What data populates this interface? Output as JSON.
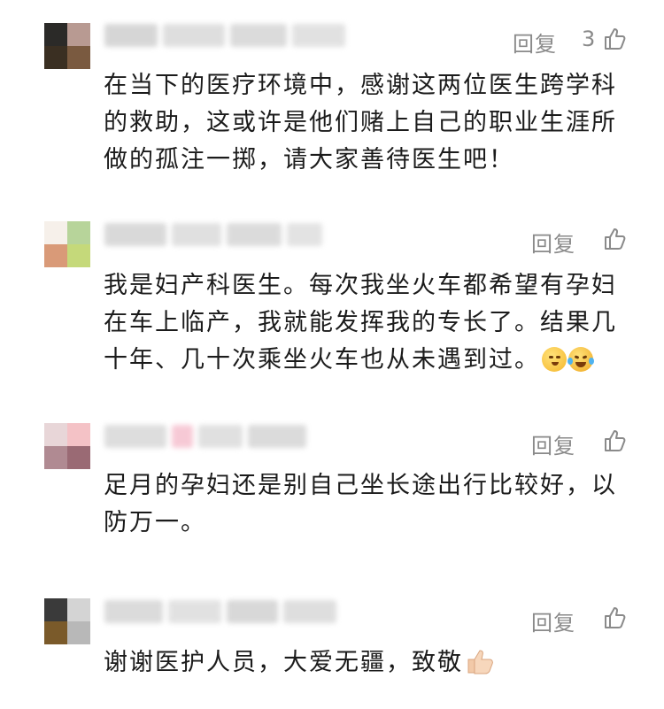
{
  "comments": [
    {
      "reply_label": "回复",
      "like_count": "3",
      "text_lines": [
        "在当下的医疗环境中，感谢这两位医生跨学科",
        "的救助，这或许是他们赌上自己的职业生涯所",
        "做的孤注一掷，请大家善待医生吧！"
      ]
    },
    {
      "reply_label": "回复",
      "like_count": "",
      "text_lines": [
        "我是妇产科医生。每次我坐火车都希望有孕妇",
        "在车上临产，我就能发挥我的专长了。结果几",
        "十年、几十次乘坐火车也从未遇到过。"
      ],
      "emojis": [
        "thinking-face-emoji",
        "crying-laughing-emoji"
      ]
    },
    {
      "reply_label": "回复",
      "like_count": "",
      "text_lines": [
        "足月的孕妇还是别自己坐长途出行比较好，以",
        "防万一。"
      ]
    },
    {
      "reply_label": "回复",
      "like_count": "",
      "text_lines": [
        "谢谢医护人员，大爱无疆，致敬"
      ],
      "emojis": [
        "thumbs-up-emoji"
      ]
    }
  ],
  "colors": {
    "text": "#1b1b1b",
    "meta": "#8a8a8a",
    "background": "#ffffff"
  }
}
